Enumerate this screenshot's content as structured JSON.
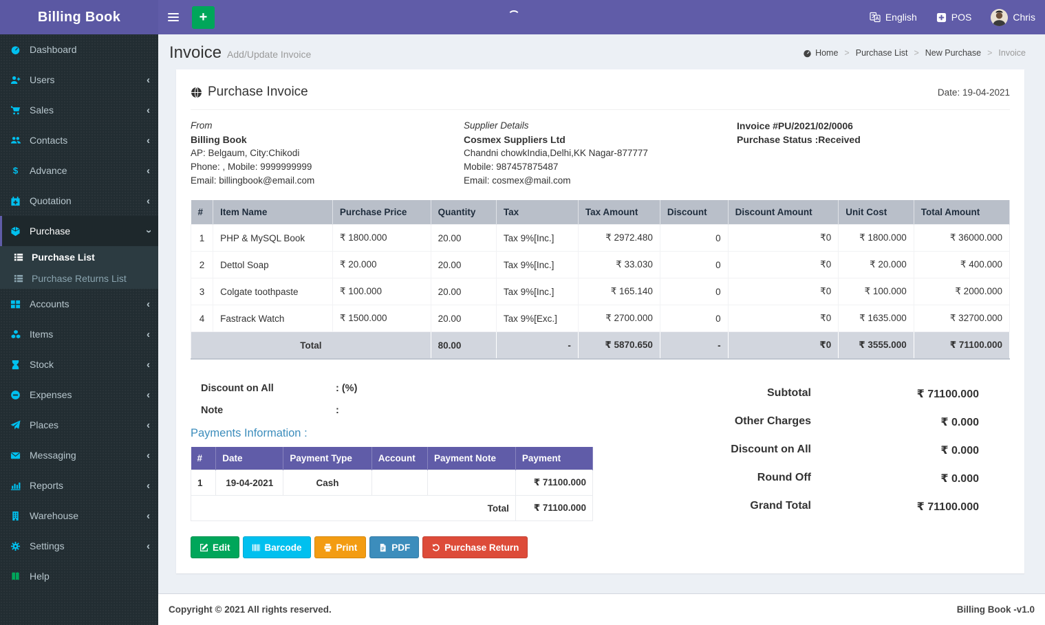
{
  "app": {
    "title": "Billing Book",
    "copyright": "Copyright © 2021 All rights reserved.",
    "version": "Billing Book -v1.0"
  },
  "topbar": {
    "language": "English",
    "pos": "POS",
    "user": "Chris"
  },
  "sidebar": {
    "items": [
      {
        "label": "Dashboard"
      },
      {
        "label": "Users"
      },
      {
        "label": "Sales"
      },
      {
        "label": "Contacts"
      },
      {
        "label": "Advance"
      },
      {
        "label": "Quotation"
      },
      {
        "label": "Purchase",
        "submenu": [
          {
            "label": "Purchase List"
          },
          {
            "label": "Purchase Returns List"
          }
        ]
      },
      {
        "label": "Accounts"
      },
      {
        "label": "Items"
      },
      {
        "label": "Stock"
      },
      {
        "label": "Expenses"
      },
      {
        "label": "Places"
      },
      {
        "label": "Messaging"
      },
      {
        "label": "Reports"
      },
      {
        "label": "Warehouse"
      },
      {
        "label": "Settings"
      },
      {
        "label": "Help"
      }
    ]
  },
  "page": {
    "title": "Invoice",
    "subtitle": "Add/Update Invoice"
  },
  "breadcrumb": [
    "Home",
    "Purchase List",
    "New Purchase",
    "Invoice"
  ],
  "invoice": {
    "card_title": "Purchase Invoice",
    "date_text": "Date: 19-04-2021",
    "from": {
      "heading": "From",
      "name": "Billing Book",
      "line1": "AP: Belgaum, City:Chikodi",
      "line2": "Phone: , Mobile: 9999999999",
      "line3": "Email: billingbook@email.com"
    },
    "supplier": {
      "heading": "Supplier Details",
      "name": "Cosmex Suppliers Ltd",
      "line1": "Chandni chowkIndia,Delhi,KK Nagar-877777",
      "line2": "Mobile: 987457875487",
      "line3": "Email: cosmex@mail.com"
    },
    "meta": {
      "invoice_no": "Invoice #PU/2021/02/0006",
      "status": "Purchase Status :Received"
    },
    "items_table": {
      "headers": [
        "#",
        "Item Name",
        "Purchase Price",
        "Quantity",
        "Tax",
        "Tax Amount",
        "Discount",
        "Discount Amount",
        "Unit Cost",
        "Total Amount"
      ],
      "rows": [
        [
          "1",
          "PHP & MySQL Book",
          "₹ 1800.000",
          "20.00",
          "Tax 9%[Inc.]",
          "₹ 2972.480",
          "0",
          "₹0",
          "₹ 1800.000",
          "₹ 36000.000"
        ],
        [
          "2",
          "Dettol Soap",
          "₹ 20.000",
          "20.00",
          "Tax 9%[Inc.]",
          "₹ 33.030",
          "0",
          "₹0",
          "₹ 20.000",
          "₹ 400.000"
        ],
        [
          "3",
          "Colgate toothpaste",
          "₹ 100.000",
          "20.00",
          "Tax 9%[Inc.]",
          "₹ 165.140",
          "0",
          "₹0",
          "₹ 100.000",
          "₹ 2000.000"
        ],
        [
          "4",
          "Fastrack Watch",
          "₹ 1500.000",
          "20.00",
          "Tax 9%[Exc.]",
          "₹ 2700.000",
          "0",
          "₹0",
          "₹ 1635.000",
          "₹ 32700.000"
        ]
      ],
      "total_row": [
        "Total",
        "80.00",
        "-",
        "₹ 5870.650",
        "-",
        "₹0",
        "₹ 3555.000",
        "₹ 71100.000"
      ]
    },
    "discount_on_all": {
      "label": "Discount on All",
      "value": ": (%)"
    },
    "note": {
      "label": "Note",
      "value": ":"
    },
    "payments": {
      "heading": "Payments Information :",
      "headers": [
        "#",
        "Date",
        "Payment Type",
        "Account",
        "Payment Note",
        "Payment"
      ],
      "rows": [
        [
          "1",
          "19-04-2021",
          "Cash",
          "",
          "",
          "₹ 71100.000"
        ]
      ],
      "total_label": "Total",
      "total_value": "₹ 71100.000"
    },
    "summary": [
      {
        "label": "Subtotal",
        "value": "₹ 71100.000"
      },
      {
        "label": "Other Charges",
        "value": "₹ 0.000"
      },
      {
        "label": "Discount on All",
        "value": "₹ 0.000"
      },
      {
        "label": "Round Off",
        "value": "₹ 0.000"
      },
      {
        "label": "Grand Total",
        "value": "₹ 71100.000"
      }
    ],
    "buttons": [
      {
        "label": "Edit",
        "color": "#00a65a"
      },
      {
        "label": "Barcode",
        "color": "#00c0ef"
      },
      {
        "label": "Print",
        "color": "#f39c12"
      },
      {
        "label": "PDF",
        "color": "#3c8dbc"
      },
      {
        "label": "Purchase Return",
        "color": "#dd4b39"
      }
    ]
  },
  "colors": {
    "navbar": "#605ca8",
    "sidebar_bg": "#222d32",
    "sidebar_icon": "#00c0ef",
    "content_bg": "#ecf0f5",
    "items_header_bg": "#b9bfc9",
    "total_row_bg": "#d2d6de",
    "payments_header_bg": "#605ca8",
    "link_heading": "#3c8dbc"
  }
}
